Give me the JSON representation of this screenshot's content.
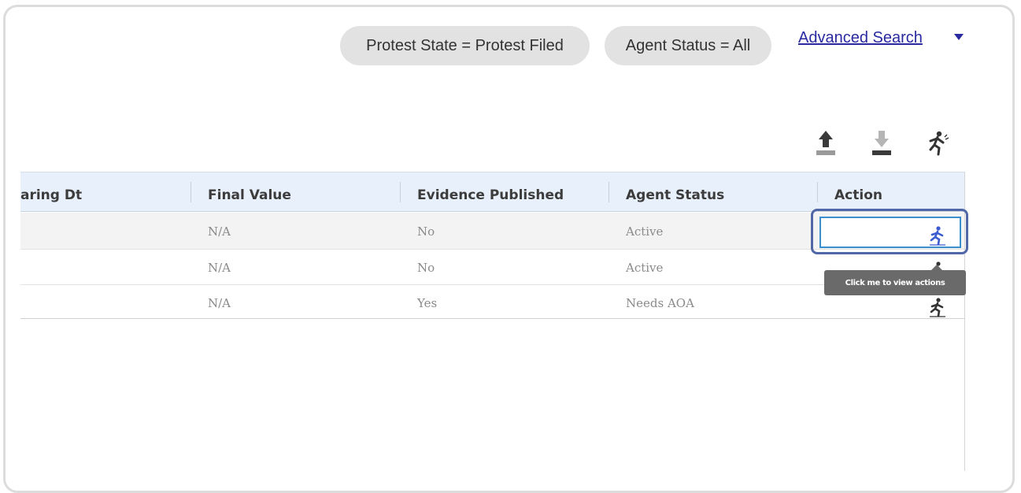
{
  "filters": {
    "chips": [
      {
        "label": "Protest State = Protest Filed"
      },
      {
        "label": "Agent Status = All"
      }
    ],
    "advanced_search_label": "Advanced Search"
  },
  "toolbar": {
    "icons": [
      "upload-icon",
      "download-icon",
      "running-person-icon"
    ]
  },
  "table": {
    "columns": [
      "aring Dt",
      "Final Value",
      "Evidence Published",
      "Agent Status",
      "Action"
    ],
    "rows": [
      {
        "final_value": "N/A",
        "evidence_published": "No",
        "agent_status": "Active",
        "action_icon": "running-person-icon"
      },
      {
        "final_value": "N/A",
        "evidence_published": "No",
        "agent_status": "Active",
        "action_icon": "running-person-icon"
      },
      {
        "final_value": "N/A",
        "evidence_published": "Yes",
        "agent_status": "Needs AOA",
        "action_icon": "running-person-icon"
      }
    ]
  },
  "tooltip": {
    "text": "Click me to view actions"
  },
  "colors": {
    "link": "#2a2aa0",
    "header_bg": "#e8f0fb",
    "focus_border": "#5168a8",
    "focus_inner": "#3a8fd0",
    "action_icon_active": "#3b5bd0",
    "action_icon_default": "#333333"
  }
}
